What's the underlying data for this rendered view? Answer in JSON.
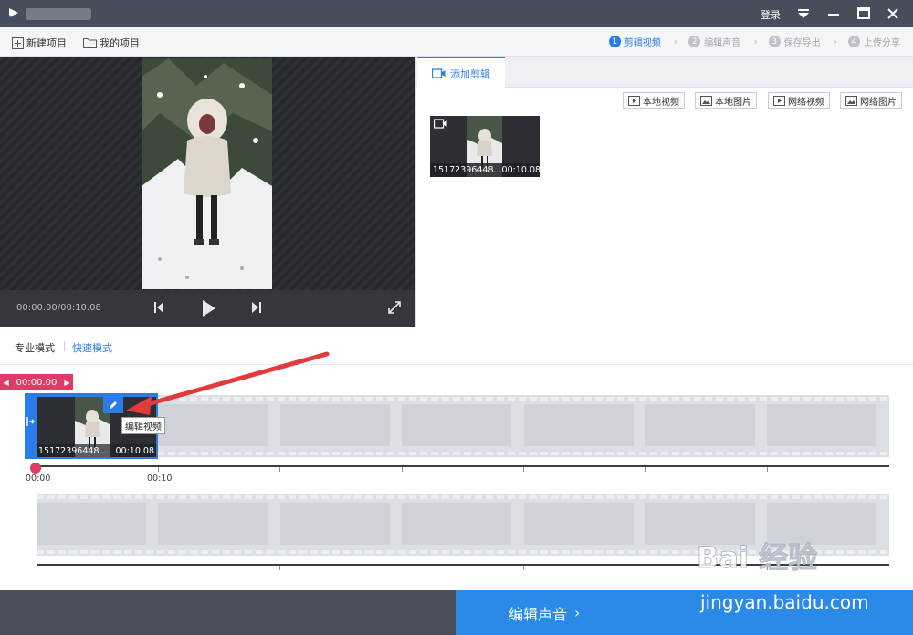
{
  "titlebar": {
    "login": "登录"
  },
  "toolbar": {
    "new_project": "新建项目",
    "my_projects": "我的项目",
    "steps": [
      {
        "num": "1",
        "label": "剪辑视频"
      },
      {
        "num": "2",
        "label": "编辑声音"
      },
      {
        "num": "3",
        "label": "保存导出"
      },
      {
        "num": "4",
        "label": "上传分享"
      }
    ]
  },
  "preview": {
    "time": "00:00.00/00:10.08"
  },
  "library": {
    "tab": "添加剪辑",
    "buttons": [
      "本地视频",
      "本地图片",
      "网络视频",
      "网络图片"
    ],
    "clip": {
      "name": "15172396448...",
      "duration": "00:10.08"
    }
  },
  "modes": {
    "pro": "专业模式",
    "quick": "快速模式"
  },
  "timeline": {
    "playhead": "00:00.00",
    "clip": {
      "name": "15172396448...",
      "duration": "00:10.08"
    },
    "tooltip": "编辑视频",
    "ticks": [
      "00:00",
      "00:10"
    ]
  },
  "footer": {
    "next": "编辑声音"
  },
  "watermark": {
    "brand": "Bai 经验",
    "url": "jingyan.baidu.com"
  },
  "colors": {
    "accent": "#2b7ce9",
    "playhead": "#e03a66",
    "titlebar": "#474d5a"
  }
}
